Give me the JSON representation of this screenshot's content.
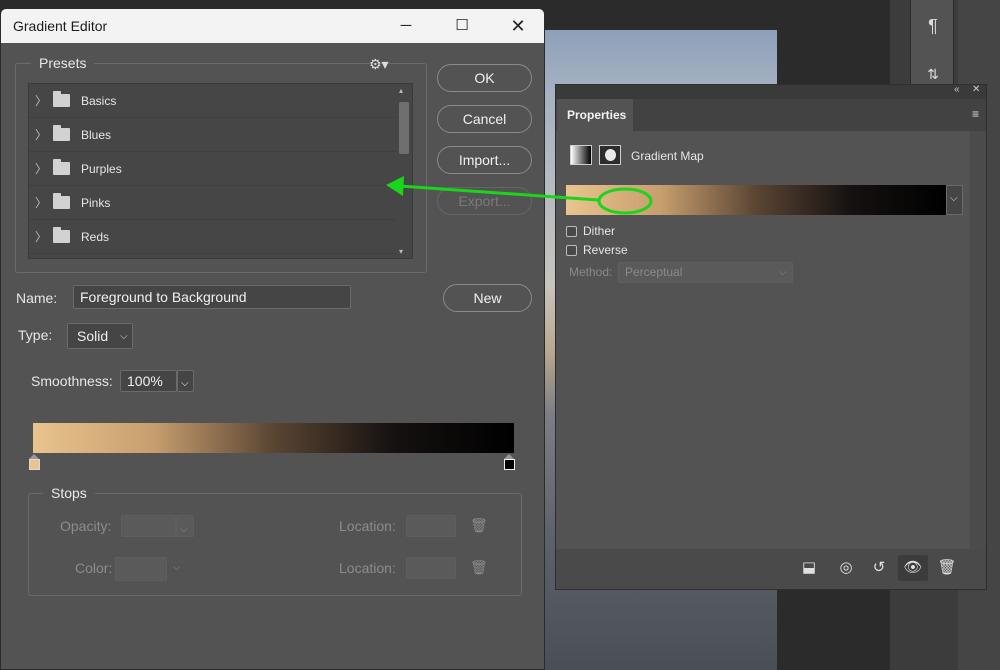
{
  "dialog": {
    "title": "Gradient Editor",
    "presets_label": "Presets",
    "presets": [
      {
        "label": "Basics"
      },
      {
        "label": "Blues"
      },
      {
        "label": "Purples"
      },
      {
        "label": "Pinks"
      },
      {
        "label": "Reds"
      }
    ],
    "buttons": {
      "ok": "OK",
      "cancel": "Cancel",
      "import": "Import...",
      "export": "Export...",
      "new": "New"
    },
    "name_label": "Name:",
    "name_value": "Foreground to Background",
    "type_label": "Type:",
    "type_value": "Solid",
    "smoothness_label": "Smoothness:",
    "smoothness_value": "100%",
    "stops_label": "Stops",
    "opacity_label": "Opacity:",
    "color_label": "Color:",
    "location_label_1": "Location:",
    "location_label_2": "Location:"
  },
  "properties": {
    "tab_label": "Properties",
    "adjustment_name": "Gradient Map",
    "dither_label": "Dither",
    "reverse_label": "Reverse",
    "method_label": "Method:",
    "method_value": "Perceptual"
  },
  "colors": {
    "gradient_start": "#e9c48e",
    "gradient_end": "#000000",
    "annotation": "#1bd51b"
  },
  "icons": {
    "close": "close-icon",
    "maximize": "maximize-icon",
    "minimize": "minimize-icon",
    "settings": "gear-icon",
    "trash": "trash-icon",
    "paragraph": "paragraph-icon"
  }
}
